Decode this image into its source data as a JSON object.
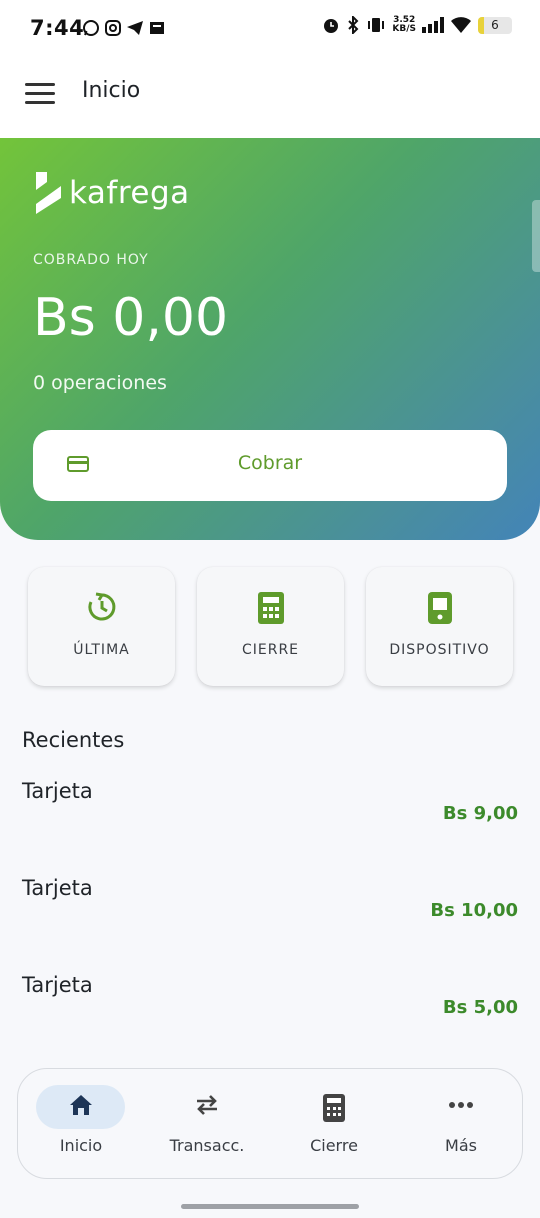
{
  "status_bar": {
    "time": "7:44",
    "net_speed_value": "3.52",
    "net_speed_unit": "KB/S",
    "battery_level": "6"
  },
  "app_bar": {
    "title": "Inicio",
    "menu_icon": "hamburger-menu-icon"
  },
  "hero": {
    "brand": "kafrega",
    "label": "COBRADO HOY",
    "amount": "Bs 0,00",
    "operations": "0 operaciones",
    "cobrar_label": "Cobrar",
    "cobrar_icon": "credit-card-icon"
  },
  "quick_actions": [
    {
      "label": "ÚLTIMA",
      "icon": "history-clock-icon"
    },
    {
      "label": "CIERRE",
      "icon": "calculator-icon"
    },
    {
      "label": "DISPOSITIVO",
      "icon": "device-phone-icon"
    }
  ],
  "recent": {
    "title": "Recientes",
    "items": [
      {
        "name": "Tarjeta",
        "amount": "Bs 9,00"
      },
      {
        "name": "Tarjeta",
        "amount": "Bs 10,00"
      },
      {
        "name": "Tarjeta",
        "amount": "Bs 5,00"
      }
    ]
  },
  "bottom_nav": {
    "items": [
      {
        "label": "Inicio",
        "icon": "home-icon",
        "active": true
      },
      {
        "label": "Transacc.",
        "icon": "swap-arrows-icon",
        "active": false
      },
      {
        "label": "Cierre",
        "icon": "calculator-icon",
        "active": false
      },
      {
        "label": "Más",
        "icon": "more-dots-icon",
        "active": false
      }
    ]
  },
  "colors": {
    "accent_green": "#5f9b2c",
    "amount_green": "#3c8a2b",
    "gradient_start": "#73c43a",
    "gradient_end": "#4384b8",
    "nav_active_pill": "#dde9f6",
    "nav_active_icon": "#1d3557"
  }
}
